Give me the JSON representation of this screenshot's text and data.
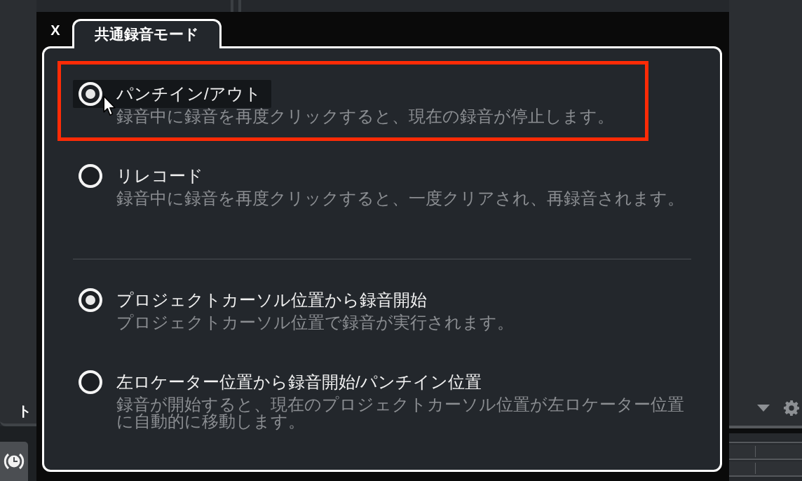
{
  "background": {
    "left_panel_text": "ト"
  },
  "dialog": {
    "close_label": "X",
    "tabs": [
      {
        "label": "共通録音モード",
        "selected": true
      }
    ],
    "groups": [
      {
        "options": [
          {
            "label": "パンチイン/アウト",
            "description": "録音中に録音を再度クリックすると、現在の録音が停止します。",
            "selected": true,
            "hovered": true,
            "highlighted": true
          },
          {
            "label": "リレコード",
            "description": "録音中に録音を再度クリックすると、一度クリアされ、再録音されます。",
            "selected": false,
            "hovered": false,
            "highlighted": false
          }
        ]
      },
      {
        "options": [
          {
            "label": "プロジェクトカーソル位置から録音開始",
            "description": "プロジェクトカーソル位置で録音が実行されます。",
            "selected": true,
            "hovered": false,
            "highlighted": false
          },
          {
            "label": "左ロケーター位置から録音開始/パンチイン位置",
            "description": "録音が開始すると、現在のプロジェクトカーソル位置が左ロケーター位置に自動的に移動します。",
            "selected": false,
            "hovered": false,
            "highlighted": false
          }
        ]
      }
    ]
  }
}
